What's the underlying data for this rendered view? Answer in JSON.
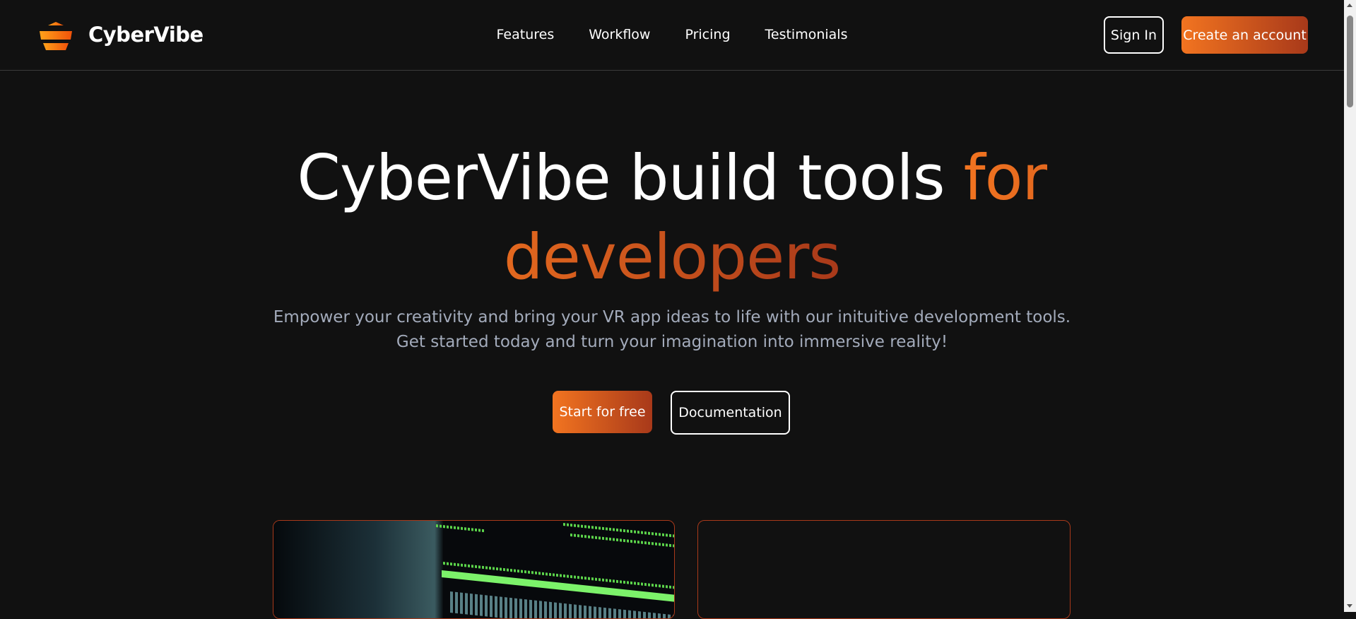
{
  "nav": {
    "brand": "CyberVibe",
    "links": [
      "Features",
      "Workflow",
      "Pricing",
      "Testimonials"
    ],
    "sign_in": "Sign In",
    "create_account": "Create an account"
  },
  "hero": {
    "title_main": "CyberVibe build tools ",
    "title_accent": "for developers",
    "subtitle_line1": "Empower your creativity and bring your VR app ideas to life with our inituitive development tools.",
    "subtitle_line2": "Get started today and turn your imagination into immersive reality!",
    "start_button": "Start for free",
    "docs_button": "Documentation"
  },
  "colors": {
    "accent_start": "#f27420",
    "accent_end": "#a8391a",
    "background": "#111111"
  }
}
